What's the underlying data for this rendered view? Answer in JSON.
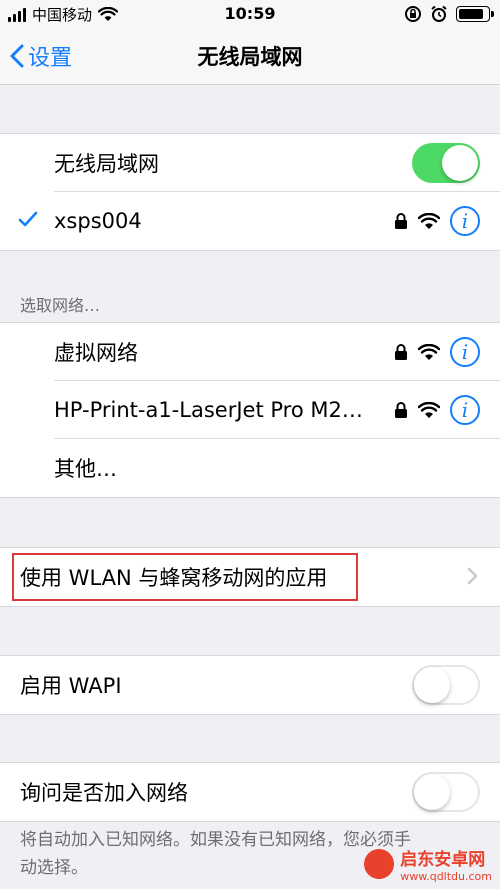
{
  "status_bar": {
    "carrier": "中国移动",
    "time": "10:59",
    "battery_percent": 85
  },
  "nav": {
    "back_label": "设置",
    "title": "无线局域网"
  },
  "wifi": {
    "label": "无线局域网",
    "enabled": true,
    "connected_network": "xsps004"
  },
  "choose_network": {
    "header": "选取网络…",
    "networks": [
      {
        "name": "虚拟网络",
        "locked": true
      },
      {
        "name": "HP-Print-a1-LaserJet Pro M2…",
        "locked": true
      }
    ],
    "other_label": "其他…"
  },
  "apps_using_wlan": {
    "label": "使用 WLAN 与蜂窝移动网的应用"
  },
  "wapi": {
    "label": "启用 WAPI",
    "enabled": false
  },
  "ask_to_join": {
    "label": "询问是否加入网络",
    "enabled": false,
    "footer": "将自动加入已知网络。如果没有已知网络，您必须手动选择。"
  },
  "watermark": {
    "title": "启东安卓网",
    "url": "www.qdltdu.com"
  },
  "colors": {
    "accent": "#157efb",
    "toggle_on": "#4cd964",
    "highlight": "#d93a3a"
  }
}
